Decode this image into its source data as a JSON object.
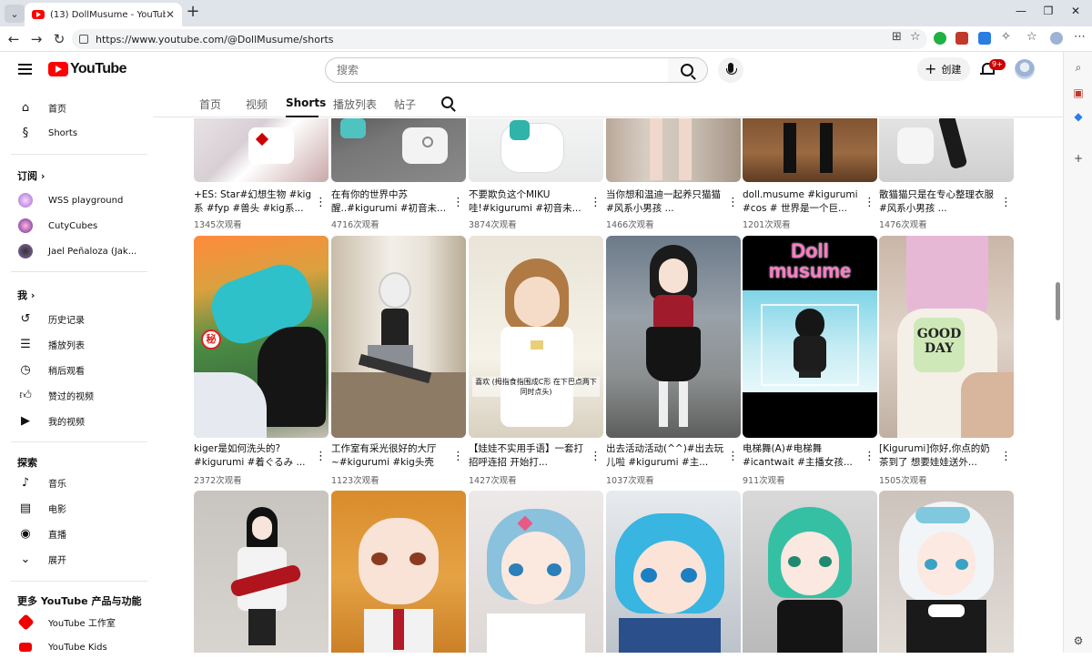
{
  "browser": {
    "tab_title": "(13) DollMusume - YouTube",
    "tab_close": "✕",
    "new_tab": "+",
    "url": "https://www.youtube.com/@DollMusume/shorts"
  },
  "header": {
    "logo_text": "YouTube",
    "search_placeholder": "搜索",
    "create_label": "创建",
    "notification_count": "9+"
  },
  "sidebar": {
    "home": "首页",
    "shorts": "Shorts",
    "subscriptions_heading": "订阅",
    "subscriptions": [
      "WSS playground",
      "CutyCubes",
      "Jael Peñaloza (Jak..."
    ],
    "you_heading": "我",
    "you_items": [
      "历史记录",
      "播放列表",
      "稍后观看",
      "赞过的视频",
      "我的视频"
    ],
    "explore_heading": "探索",
    "explore_items": [
      "音乐",
      "电影",
      "直播",
      "展开"
    ],
    "more_heading": "更多 YouTube 产品与功能",
    "more_items": [
      "YouTube 工作室",
      "YouTube Kids"
    ]
  },
  "channel_tabs": [
    "首页",
    "视频",
    "Shorts",
    "播放列表",
    "帖子"
  ],
  "colors": {
    "brand_red": "#ff0000",
    "text_primary": "#0f0f0f",
    "text_secondary": "#606060"
  },
  "shorts": [
    [
      {
        "title": "+ES: Star#幻想生物 #kig系 #fyp #兽头 #kig系...",
        "views": "1345次观看"
      },
      {
        "title": "在有你的世界中苏醒..#kigurumi #初音未...",
        "views": "4716次观看"
      },
      {
        "title": "不要欺负这个MIKU哇!#kigurumi #初音未...",
        "views": "3874次观看"
      },
      {
        "title": "当你想和温迪一起养只猫猫 #风系小男孩 ...",
        "views": "1466次观看"
      },
      {
        "title": "doll.musume #kigurumi #cos # 世界是一个巨...",
        "views": "1201次观看"
      },
      {
        "title": "散猫猫只是在专心整理衣服#风系小男孩 ...",
        "views": "1476次观看"
      }
    ],
    [
      {
        "title": "kiger是如何洗头的? #kigurumi #着ぐるみ ...",
        "views": "2372次观看"
      },
      {
        "title": "工作室有采光很好的大厅~#kigurumi #kig头壳",
        "views": "1123次观看"
      },
      {
        "title": "【娃娃不实用手语】一套打招呼连招 开始打...",
        "views": "1427次观看"
      },
      {
        "title": "出去活动活动(^^)#出去玩儿啦 #kigurumi #主...",
        "views": "1037次观看"
      },
      {
        "title": "电梯舞(A)#电梯舞 #icantwait #主播女孩...",
        "views": "911次观看"
      },
      {
        "title": "[Kigurumi]你好,你点的奶茶到了 想要娃娃送外...",
        "views": "1505次观看"
      }
    ],
    [
      {
        "title": "",
        "views": ""
      },
      {
        "title": "",
        "views": ""
      },
      {
        "title": "",
        "views": ""
      },
      {
        "title": "",
        "views": ""
      },
      {
        "title": "",
        "views": ""
      },
      {
        "title": "",
        "views": ""
      }
    ]
  ],
  "thumb_overlays": {
    "doll_logo_line1": "Doll",
    "doll_logo_line2": "musume",
    "good_day": "GOOD DAY",
    "sign_caption": "喜欢 (拇指食指围成C形 在下巴点两下 同时点头)",
    "secret_mark": "秘"
  }
}
